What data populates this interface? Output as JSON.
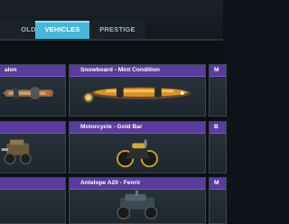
{
  "tabs": [
    {
      "label": "SOLDIERS",
      "display": "OLDIERS"
    },
    {
      "label": "VEHICLES",
      "display": "VEHICLES"
    },
    {
      "label": "PRESTIGE WEAPON",
      "display": "PRESTIGE WEAPON"
    }
  ],
  "active_tab": "VEHICLES",
  "colors": {
    "active_tab": "#4ab6d8",
    "card_header": "#5a3c9c",
    "background": "#0d1318"
  },
  "cards": [
    {
      "title": "alon",
      "image": "wingsuit-icon"
    },
    {
      "title": "Snowboard - Mint Condition",
      "image": "snowboard-icon"
    },
    {
      "title": "M",
      "image": "vehicle-icon"
    },
    {
      "title": "",
      "image": "atv-icon"
    },
    {
      "title": "Motorcycle - Gold Bar",
      "image": "motorcycle-icon"
    },
    {
      "title": "B",
      "image": "vehicle-icon"
    },
    {
      "title": "",
      "image": "vehicle-icon"
    },
    {
      "title": "Antelope A20 - Fenrir",
      "image": "antelope-icon"
    },
    {
      "title": "M",
      "image": "vehicle-icon"
    }
  ]
}
